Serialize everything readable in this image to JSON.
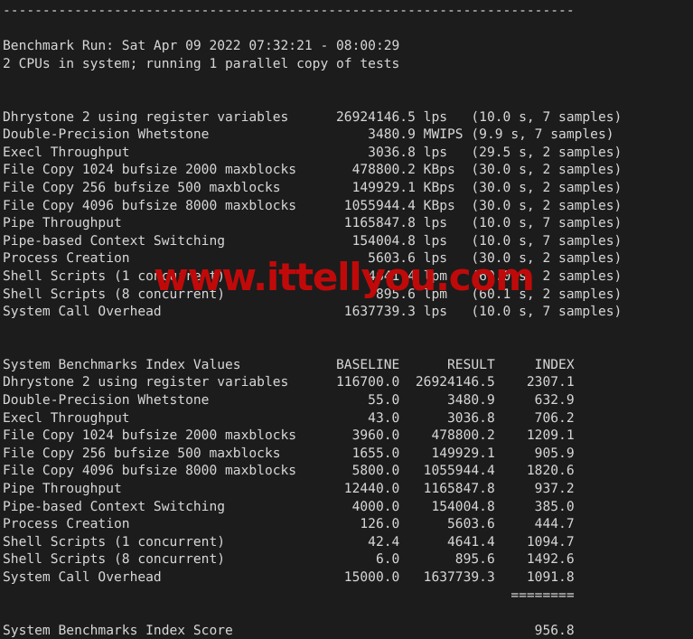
{
  "terminal": {
    "background_color": "#1c1c1c",
    "foreground_color": "#d6d6d6",
    "separator_top": "------------------------------------------------------------------------",
    "header": {
      "benchmark_run": "Benchmark Run: Sat Apr 09 2022 07:32:21 - 08:00:29",
      "cpu_info": "2 CPUs in system; running 1 parallel copy of tests"
    },
    "raw_results": {
      "rows": [
        {
          "name": "Dhrystone 2 using register variables",
          "value": "26924146.5",
          "unit": "lps",
          "timing": "(10.0 s, 7 samples)"
        },
        {
          "name": "Double-Precision Whetstone",
          "value": "3480.9",
          "unit": "MWIPS",
          "timing": "(9.9 s, 7 samples)"
        },
        {
          "name": "Execl Throughput",
          "value": "3036.8",
          "unit": "lps",
          "timing": "(29.5 s, 2 samples)"
        },
        {
          "name": "File Copy 1024 bufsize 2000 maxblocks",
          "value": "478800.2",
          "unit": "KBps",
          "timing": "(30.0 s, 2 samples)"
        },
        {
          "name": "File Copy 256 bufsize 500 maxblocks",
          "value": "149929.1",
          "unit": "KBps",
          "timing": "(30.0 s, 2 samples)"
        },
        {
          "name": "File Copy 4096 bufsize 8000 maxblocks",
          "value": "1055944.4",
          "unit": "KBps",
          "timing": "(30.0 s, 2 samples)"
        },
        {
          "name": "Pipe Throughput",
          "value": "1165847.8",
          "unit": "lps",
          "timing": "(10.0 s, 7 samples)"
        },
        {
          "name": "Pipe-based Context Switching",
          "value": "154004.8",
          "unit": "lps",
          "timing": "(10.0 s, 7 samples)"
        },
        {
          "name": "Process Creation",
          "value": "5603.6",
          "unit": "lps",
          "timing": "(30.0 s, 2 samples)"
        },
        {
          "name": "Shell Scripts (1 concurrent)",
          "value": "4641.4",
          "unit": "lpm",
          "timing": "(60.0 s, 2 samples)"
        },
        {
          "name": "Shell Scripts (8 concurrent)",
          "value": "895.6",
          "unit": "lpm",
          "timing": "(60.1 s, 2 samples)"
        },
        {
          "name": "System Call Overhead",
          "value": "1637739.3",
          "unit": "lps",
          "timing": "(10.0 s, 7 samples)"
        }
      ]
    },
    "index_table": {
      "title": "System Benchmarks Index Values",
      "columns": [
        "BASELINE",
        "RESULT",
        "INDEX"
      ],
      "rows": [
        {
          "name": "Dhrystone 2 using register variables",
          "baseline": "116700.0",
          "result": "26924146.5",
          "index": "2307.1"
        },
        {
          "name": "Double-Precision Whetstone",
          "baseline": "55.0",
          "result": "3480.9",
          "index": "632.9"
        },
        {
          "name": "Execl Throughput",
          "baseline": "43.0",
          "result": "3036.8",
          "index": "706.2"
        },
        {
          "name": "File Copy 1024 bufsize 2000 maxblocks",
          "baseline": "3960.0",
          "result": "478800.2",
          "index": "1209.1"
        },
        {
          "name": "File Copy 256 bufsize 500 maxblocks",
          "baseline": "1655.0",
          "result": "149929.1",
          "index": "905.9"
        },
        {
          "name": "File Copy 4096 bufsize 8000 maxblocks",
          "baseline": "5800.0",
          "result": "1055944.4",
          "index": "1820.6"
        },
        {
          "name": "Pipe Throughput",
          "baseline": "12440.0",
          "result": "1165847.8",
          "index": "937.2"
        },
        {
          "name": "Pipe-based Context Switching",
          "baseline": "4000.0",
          "result": "154004.8",
          "index": "385.0"
        },
        {
          "name": "Process Creation",
          "baseline": "126.0",
          "result": "5603.6",
          "index": "444.7"
        },
        {
          "name": "Shell Scripts (1 concurrent)",
          "baseline": "42.4",
          "result": "4641.4",
          "index": "1094.7"
        },
        {
          "name": "Shell Scripts (8 concurrent)",
          "baseline": "6.0",
          "result": "895.6",
          "index": "1492.6"
        },
        {
          "name": "System Call Overhead",
          "baseline": "15000.0",
          "result": "1637739.3",
          "index": "1091.8"
        }
      ],
      "separator": "========",
      "score_label": "System Benchmarks Index Score",
      "score_value": "956.8"
    },
    "watermark": {
      "text": "www.ittellyou.com",
      "color": "#c00a0a"
    }
  }
}
